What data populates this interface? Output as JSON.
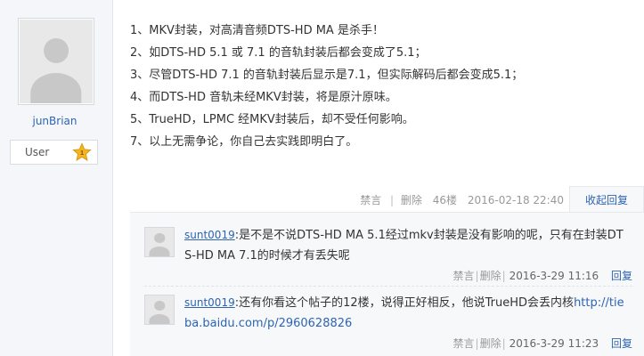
{
  "author": {
    "username": "junBrian",
    "badge_label": "User",
    "level": "1"
  },
  "post": {
    "lines": [
      "1、MKV封装，对高清音频DTS-HD MA 是杀手！",
      "2、如DTS-HD 5.1 或 7.1 的音轨封装后都会变成了5.1；",
      "3、尽管DTS-HD 7.1 的音轨封装后显示是7.1，但实际解码后都会变成5.1；",
      "4、而DTS-HD 音轨未经MKV封装，将是原汁原味。",
      "5、TrueHD，LPMC 经MKV封装后，却不受任何影响。",
      "7、以上无需争论，你自己去实践即明白了。"
    ],
    "meta": {
      "report": "禁言",
      "delete": "删除",
      "floor": "46楼",
      "time": "2016-02-18 22:40"
    },
    "fold_reply_label": "收起回复"
  },
  "replies": [
    {
      "user": "sunt0019",
      "colon": ":",
      "text": "是不是不说DTS-HD MA 5.1经过mkv封装是没有影响的呢，只有在封装DTS-HD MA 7.1的时候才有丢失呢",
      "link": "",
      "report": "禁言",
      "delete": "删除",
      "time": "2016-3-29 11:16",
      "reply": "回复"
    },
    {
      "user": "sunt0019",
      "colon": ":",
      "text": "还有你看这个帖子的12楼，说得正好相反，他说TrueHD会丢内核",
      "link": "http://tieba.baidu.com/p/2960628826",
      "report": "禁言",
      "delete": "删除",
      "time": "2016-3-29 11:23",
      "reply": "回复"
    }
  ],
  "colors": {
    "link_blue": "#2d64b3",
    "panel_bg": "#f4f6f9",
    "reply_bg": "#f7f8fa",
    "star": "#f5b520"
  },
  "icons": {
    "level_badge": "star-level-icon",
    "avatar": "user-avatar-placeholder"
  }
}
